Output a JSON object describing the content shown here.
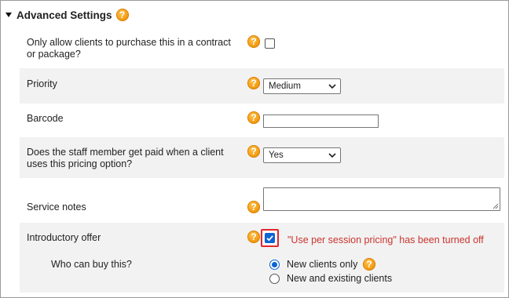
{
  "section": {
    "title": "Advanced Settings",
    "help_glyph": "?"
  },
  "fields": {
    "contract": {
      "label_line1": "Only allow clients to purchase this in a contract",
      "label_line2": "or package?",
      "checked": false
    },
    "priority": {
      "label": "Priority",
      "value": "Medium"
    },
    "barcode": {
      "label": "Barcode",
      "value": ""
    },
    "staff_paid": {
      "label_line1": "Does the staff member get paid when a client",
      "label_line2": "uses this pricing option?",
      "value": "Yes"
    },
    "service_notes": {
      "label": "Service notes",
      "value": ""
    },
    "intro_offer": {
      "label": "Introductory offer",
      "checked": true,
      "warning": "\"Use per session pricing\" has been turned off"
    },
    "who_can_buy": {
      "label": "Who can buy this?",
      "options": [
        {
          "label": "New clients only",
          "selected": true
        },
        {
          "label": "New and existing clients",
          "selected": false
        }
      ]
    }
  },
  "colors": {
    "accent_blue": "#0b64d1",
    "help_orange": "#f39c12",
    "warning_red": "#c9342e",
    "highlight_border": "#e0262a",
    "row_shade": "#f2f2f2"
  }
}
